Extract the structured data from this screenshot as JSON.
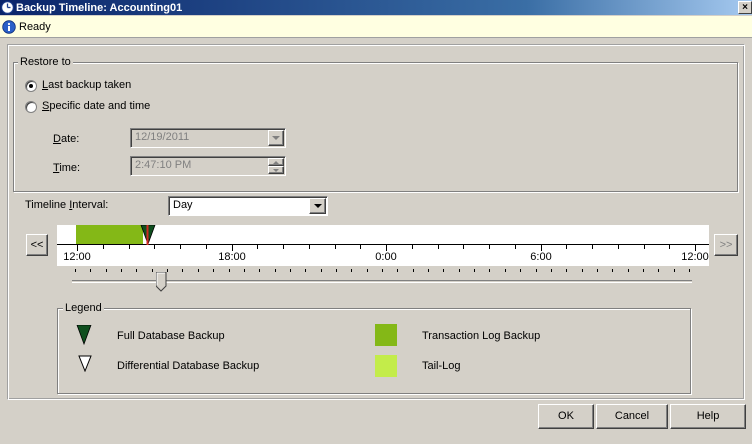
{
  "window": {
    "title": "Backup Timeline: Accounting01",
    "close_label": "×"
  },
  "status": {
    "text": "Ready"
  },
  "restore": {
    "group_label": "Restore to",
    "option_last": {
      "prefix": "",
      "accel": "L",
      "rest": "ast backup taken",
      "checked": true
    },
    "option_specific": {
      "prefix": "",
      "accel": "S",
      "rest": "pecific date and time",
      "checked": false
    },
    "date_label": {
      "accel": "D",
      "rest": "ate:"
    },
    "date_value": "12/19/2011",
    "time_label": {
      "accel": "T",
      "rest": "ime:"
    },
    "time_value": "2:47:10 PM"
  },
  "timeline": {
    "interval_label": {
      "prefix": "Timeline ",
      "accel": "I",
      "rest": "nterval:"
    },
    "interval_value": "Day",
    "prev_label": "<<",
    "next_label": ">>",
    "tick_labels": [
      "12:00",
      "18:00",
      "0:00",
      "6:00",
      "12:00"
    ],
    "slider_value_fraction": 0.14
  },
  "legend": {
    "label": "Legend",
    "items": [
      {
        "label": "Full Database Backup",
        "icon": "full-backup-triangle-icon"
      },
      {
        "label": "Differential Database Backup",
        "icon": "differential-backup-triangle-icon"
      },
      {
        "label": "Transaction Log Backup",
        "icon": "transaction-log-swatch",
        "color": "#84b817"
      },
      {
        "label": "Tail-Log",
        "icon": "tail-log-swatch",
        "color": "#c3ec4a"
      }
    ]
  },
  "buttons": {
    "ok": "OK",
    "cancel": "Cancel",
    "help": "Help"
  },
  "colors": {
    "transaction_log": "#84b817",
    "tail_log": "#c3ec4a",
    "full_backup": "#0f4f1e",
    "marker": "#d12a20"
  }
}
